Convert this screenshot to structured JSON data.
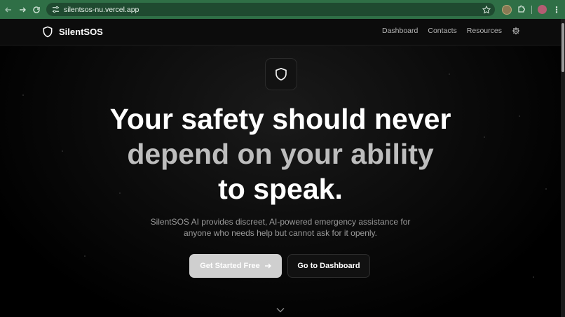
{
  "browser": {
    "url": "silentsos-nu.vercel.app"
  },
  "header": {
    "brand": "SilentSOS",
    "nav": [
      "Dashboard",
      "Contacts",
      "Resources"
    ]
  },
  "hero": {
    "headline_line1": "Your safety should never",
    "headline_line2": "depend on your ability",
    "headline_line3": "to speak.",
    "subtitle_line1": "SilentSOS AI provides discreet, AI-powered emergency assistance for",
    "subtitle_line2": "anyone who needs help but cannot ask for it openly.",
    "primary_button": "Get Started Free",
    "secondary_button": "Go to Dashboard"
  },
  "icons": {
    "brand": "shield-icon",
    "settings": "gear-icon",
    "scroll": "chevron-down-icon"
  }
}
